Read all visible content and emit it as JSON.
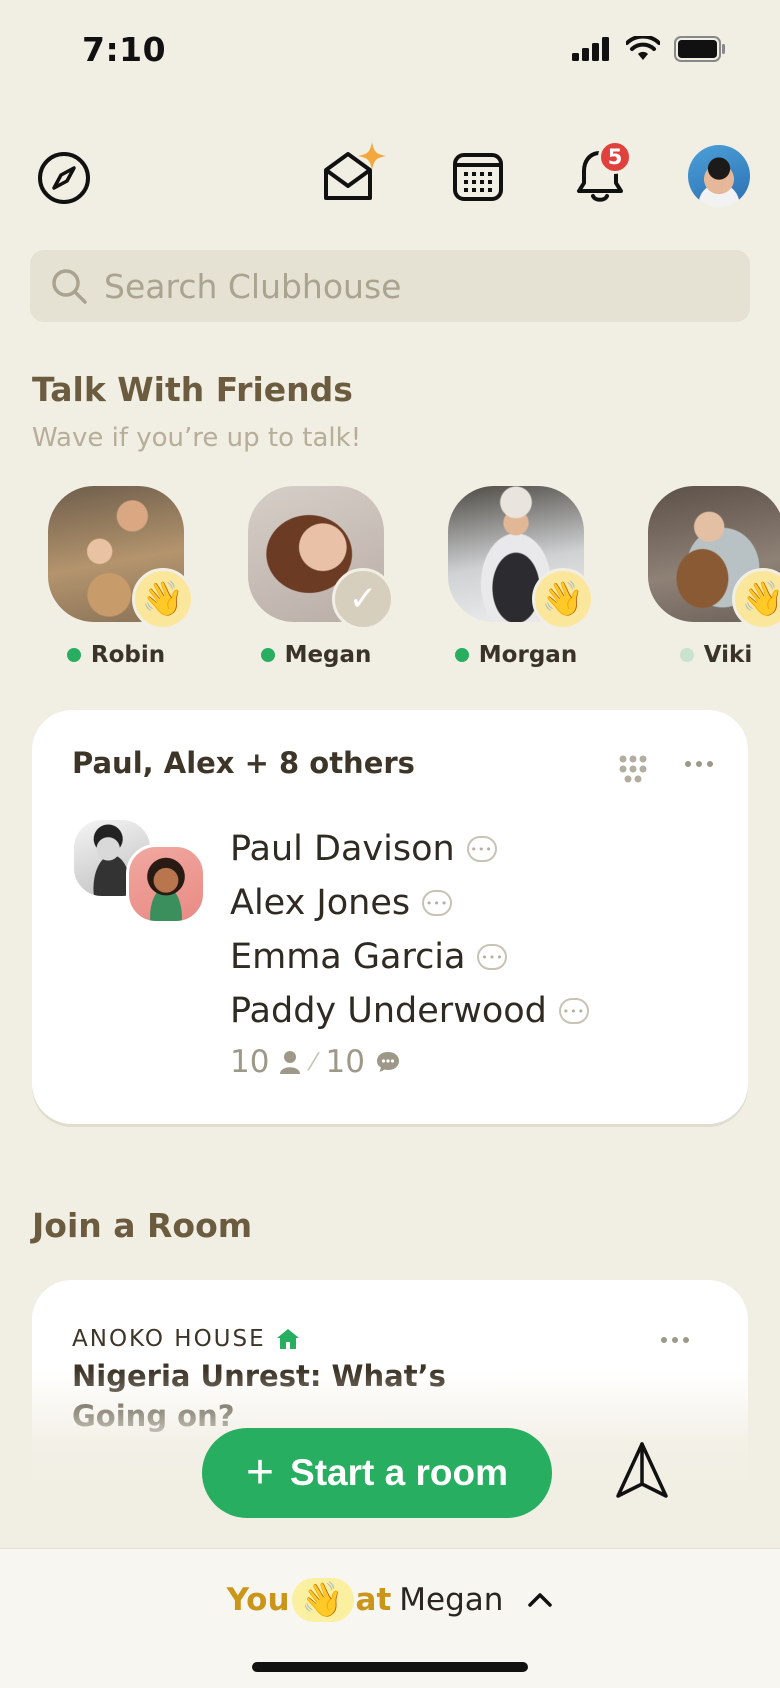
{
  "status": {
    "time": "7:10"
  },
  "nav": {
    "notifications_count": "5"
  },
  "search": {
    "placeholder": "Search Clubhouse"
  },
  "friends_section": {
    "title": "Talk With Friends",
    "subtitle": "Wave if you’re up to talk!",
    "friends": [
      {
        "name": "Robin",
        "status": "wave"
      },
      {
        "name": "Megan",
        "status": "waved"
      },
      {
        "name": "Morgan",
        "status": "wave"
      },
      {
        "name": "Viki",
        "status": "wave"
      }
    ]
  },
  "room_card": {
    "title": "Paul, Alex + 8 others",
    "speakers": [
      "Paul Davison",
      "Alex Jones",
      "Emma Garcia",
      "Paddy Underwood"
    ],
    "listeners": "10",
    "messages": "10"
  },
  "join_section": {
    "title": "Join a Room",
    "club": "ANOKO HOUSE",
    "room_title": "Nigeria Unrest: What’s Going on?"
  },
  "start_button": {
    "label": "Start a room",
    "icon": "+"
  },
  "wave_bar": {
    "you": "You",
    "at": "at",
    "name": "Megan",
    "emoji": "👋"
  },
  "colors": {
    "accent_green": "#27ae60",
    "background": "#f1eee3",
    "badge_red": "#e0413c"
  }
}
